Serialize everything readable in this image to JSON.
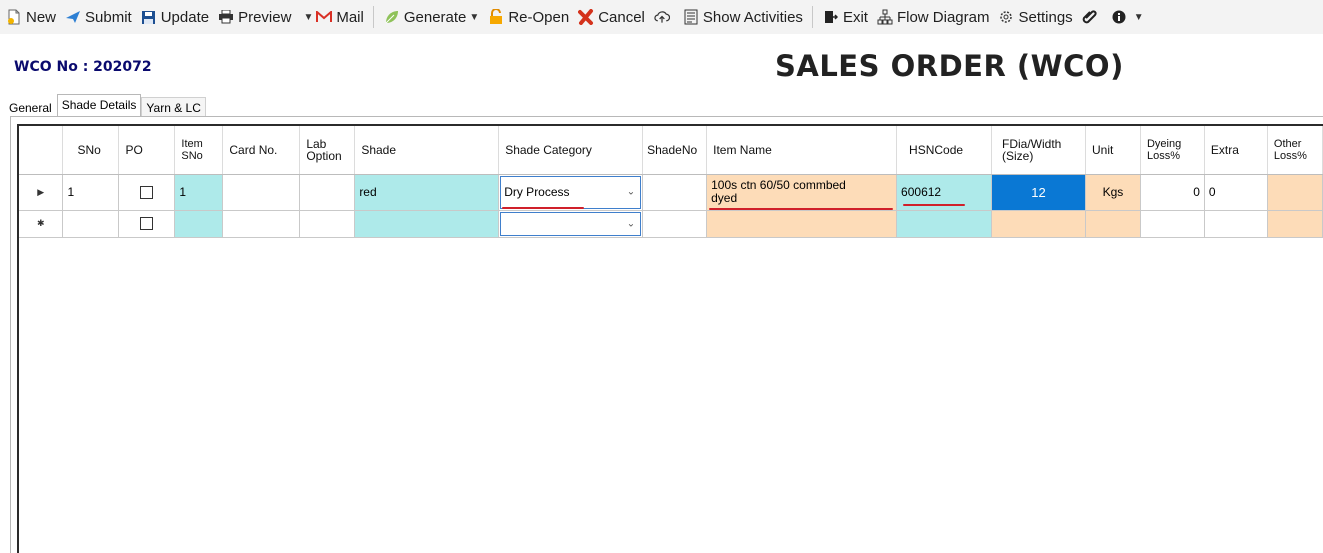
{
  "toolbar": {
    "new": "New",
    "submit": "Submit",
    "update": "Update",
    "preview": "Preview",
    "mail": "Mail",
    "generate": "Generate",
    "reopen": "Re-Open",
    "cancel": "Cancel",
    "show_activities": "Show Activities",
    "exit": "Exit",
    "flow_diagram": "Flow Diagram",
    "settings": "Settings"
  },
  "header": {
    "wco_no": "WCO No : 202072",
    "title": "SALES ORDER (WCO)"
  },
  "tabs": [
    "General",
    "Shade Details",
    "Yarn & LC"
  ],
  "grid": {
    "columns": {
      "sno": "SNo",
      "po": "PO",
      "item_sno_1": "Item",
      "item_sno_2": "SNo",
      "card_no": "Card No.",
      "lab_option_1": "Lab",
      "lab_option_2": "Option",
      "shade": "Shade",
      "shade_category": "Shade Category",
      "shade_no": "ShadeNo",
      "item_name": "Item Name",
      "hsn_code": "HSNCode",
      "fdia_1": "FDia/Width",
      "fdia_2": "(Size)",
      "unit": "Unit",
      "dyeing_loss_1": "Dyeing",
      "dyeing_loss_2": "Loss%",
      "extra": "Extra",
      "other_loss_1": "Other",
      "other_loss_2": "Loss%"
    },
    "rows": [
      {
        "sno": "1",
        "item_sno": "1",
        "shade": "red",
        "shade_category": "Dry Process",
        "item_name_line1": "100s ctn 60/50 commbed",
        "item_name_line2": "dyed",
        "hsn_code": "600612",
        "fdia": "12",
        "unit": "Kgs",
        "dyeing_loss": "0",
        "extra": "0"
      }
    ]
  },
  "colors": {
    "cyan_cell": "#aeeaea",
    "peach_cell": "#fddcb8",
    "selected_cell": "#0a78d4",
    "annotation_red": "#d0202a"
  }
}
